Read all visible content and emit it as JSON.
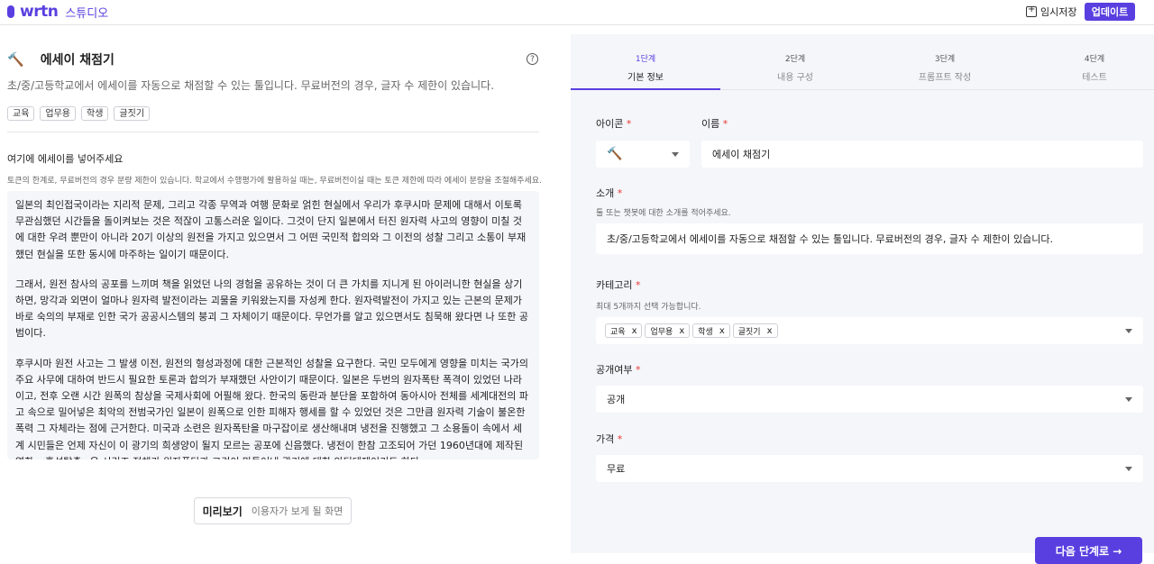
{
  "app": {
    "logo": "wrtn",
    "studio_label": "스튜디오"
  },
  "header": {
    "save_label": "임시저장",
    "update_label": "업데이트"
  },
  "tool": {
    "title": "에세이 채점기",
    "icon": "hammer",
    "description": "초/중/고등학교에서 에세이를 자동으로 채점할 수 있는 툴입니다. 무료버전의 경우, 글자 수 제한이 있습니다.",
    "tags": [
      "교육",
      "업무용",
      "학생",
      "글짓기"
    ]
  },
  "essay_input": {
    "label": "여기에 에세이를 넣어주세요",
    "hint": "토큰의 한계로, 무료버전의 경우 분량 제한이 있습니다. 학교에서 수행평가에 활용하실 때는, 무료버전이실 때는 토큰 제한에 따라 에세이 분량을 조절해주세요.",
    "paragraphs": [
      " 일본의 최인접국이라는 지리적 문제, 그리고 각종 무역과 여행 문화로 얽힌 현실에서 우리가 후쿠시마 문제에 대해서 이토록 무관심했던 시간들을 돌이켜보는 것은 적잖이 고통스러운 일이다. 그것이 단지 일본에서 터진 원자력 사고의 영향이 미칠 것에 대한 우려 뿐만이 아니라 20기 이상의 원전을 가지고 있으면서 그 어떤 국민적 합의와 그 이전의 성찰 그리고 소통이 부재했던 현실을 또한 동시에 마주하는 일이기 때문이다.",
      " 그래서, 원전 참사의 공포를 느끼며 책을 읽었던 나의 경험을 공유하는 것이 더 큰 가치를 지니게 된 아이러니한 현실을 상기하면, 망각과 외면이 얼마나 원자력 발전이라는 괴물을 키워왔는지를 자성케 한다. 원자력발전이 가지고 있는 근본의 문제가 바로 숙의의 부재로 인한 국가 공공시스템의 붕괴 그 자체이기 때문이다. 무언가를 알고 있으면서도 침묵해 왔다면 나 또한 공범이다.",
      " 후쿠시마 원전 사고는 그 발생 이전, 원전의 형성과정에 대한 근본적인 성찰을 요구한다. 국민 모두에게 영향을 미치는 국가의 주요 사무에 대하여 반드시 필요한 토론과 합의가 부재했던 사안이기 때문이다. 일본은 두번의 원자폭탄 폭격이 있었던 나라이고, 전후 오랜 시간 원폭의 참상을 국제사회에 어필해 왔다. 한국의 동란과 분단을 포함하여 동아시아 전체를 세계대전의 파고 속으로 밀어넣은 최악의 전범국가인 일본이 원폭으로 인한 피해자 행세를 할 수 있었던 것은 그만큼 원자력 기술이 불온한 폭력 그 자체라는 점에 근거한다. 미국과 소련은 원자폭탄을 마구잡이로 생산해내며 냉전을 진행했고 그 소용돌이 속에서 세계 시민들은 언제 자신이 이 광기의 희생양이 될지 모르는 공포에 신음했다. 냉전이 한참 고조되어 가던 1960년대에 제작된 영화 <혹성탈출>은 시리즈 전체가 원자폭탄과 그것이 만들어낸 광기에 대한 안티테제이기도 하다."
    ]
  },
  "preview": {
    "label": "미리보기",
    "sub": "이용자가 보게 될 화면"
  },
  "steps": [
    {
      "num": "1단계",
      "name": "기본 정보",
      "active": true
    },
    {
      "num": "2단계",
      "name": "내용 구성",
      "active": false
    },
    {
      "num": "3단계",
      "name": "프롬프트 작성",
      "active": false
    },
    {
      "num": "4단계",
      "name": "테스트",
      "active": false
    }
  ],
  "form": {
    "icon_label": "아이콘",
    "name_label": "이름",
    "name_value": "에세이 채점기",
    "intro_label": "소개",
    "intro_hint": "툴 또는 챗봇에 대한 소개를 적어주세요.",
    "intro_value": "초/중/고등학교에서 에세이를 자동으로 채점할 수 있는 툴입니다. 무료버전의 경우, 글자 수 제한이 있습니다.",
    "category_label": "카테고리",
    "category_hint": "최대 5개까지 선택 가능합니다.",
    "categories": [
      "교육",
      "업무용",
      "학생",
      "글짓기"
    ],
    "chip_remove": "x",
    "visibility_label": "공개여부",
    "visibility_value": "공개",
    "price_label": "가격",
    "price_value": "무료",
    "required_mark": "*"
  },
  "next_label": "다음 단계로 →",
  "colors": {
    "accent": "#5a3fe0",
    "required": "#e53935",
    "panel_bg": "#f5f6fa"
  }
}
